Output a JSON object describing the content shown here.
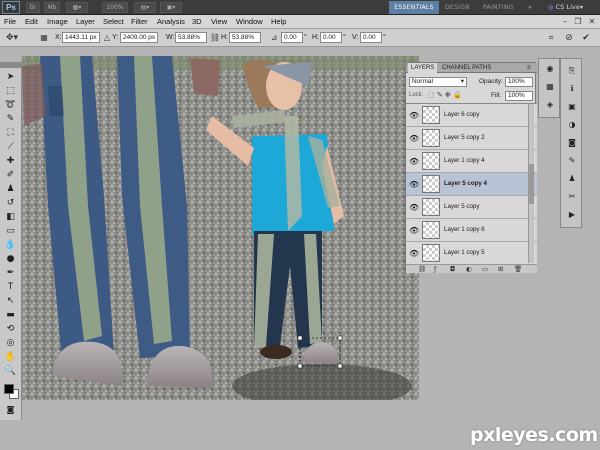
{
  "app": {
    "logo_text": "Ps",
    "zoom": "100%",
    "live_label": "CS Live"
  },
  "workspace": {
    "active": "ESSENTIALS",
    "others": [
      "DESIGN",
      "PAINTING"
    ],
    "overflow": "»"
  },
  "menu": [
    "File",
    "Edit",
    "Image",
    "Layer",
    "Select",
    "Filter",
    "Analysis",
    "3D",
    "View",
    "Window",
    "Help"
  ],
  "options": {
    "x_label": "X:",
    "x_value": "1443.11 px",
    "y_label": "Y:",
    "y_value": "2409.00 px",
    "w_label": "W:",
    "w_value": "53.88%",
    "h_label": "H:",
    "h_value": "53.88%",
    "angle_value": "0.00",
    "angle_unit": "°",
    "hskew_label": "H:",
    "hskew_value": "0.00",
    "vskew_label": "V:",
    "vskew_value": "0.00",
    "deg": "°"
  },
  "layers_panel": {
    "tabs": [
      "LAYERS",
      "CHANNEL PATHS"
    ],
    "blend_mode": "Normal",
    "opacity_label": "Opacity:",
    "opacity_value": "100%",
    "lock_label": "Lock:",
    "fill_label": "Fill:",
    "fill_value": "100%",
    "layers": [
      {
        "name": "Layer 6 copy",
        "selected": false
      },
      {
        "name": "Layer 5 copy 2",
        "selected": false
      },
      {
        "name": "Layer 1 copy 4",
        "selected": false
      },
      {
        "name": "Layer 5 copy 4",
        "selected": true
      },
      {
        "name": "Layer 5 copy",
        "selected": false
      },
      {
        "name": "Layer 1 copy 8",
        "selected": false
      },
      {
        "name": "Layer 1 copy 5",
        "selected": false
      }
    ],
    "footer_icons": [
      "link-icon",
      "fx-icon",
      "mask-icon",
      "adjustment-icon",
      "group-icon",
      "new-layer-icon",
      "trash-icon"
    ]
  },
  "watermark": "pxleyes.com",
  "colors": {
    "appbar": "#3c3c3c",
    "accent": "#5d7fa3",
    "selected_layer": "#b8c4d6"
  }
}
